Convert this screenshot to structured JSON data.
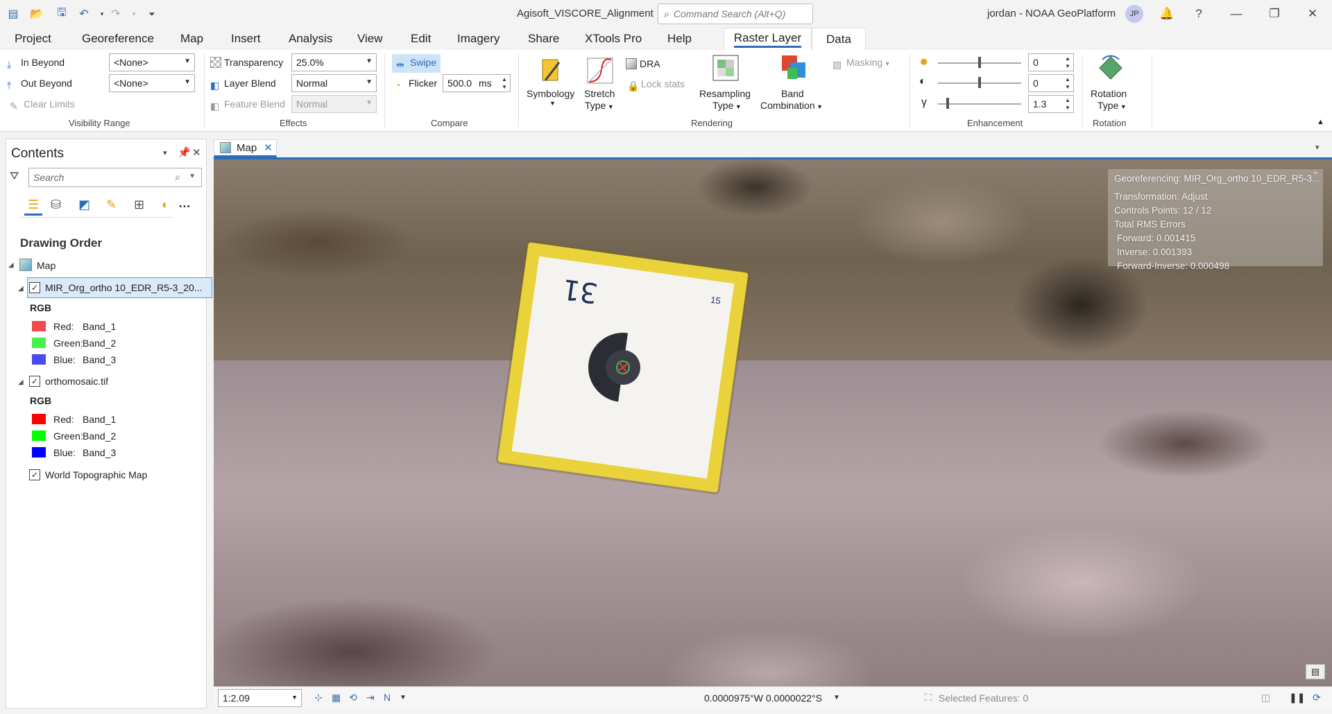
{
  "titlebar": {
    "app_title": "Agisoft_VISCORE_Alignment",
    "search_placeholder": "Command Search (Alt+Q)",
    "user": "jordan - NOAA GeoPlatform",
    "avatar_initials": "JP",
    "help": "?"
  },
  "menu": {
    "items": [
      "Project",
      "Georeference",
      "Map",
      "Insert",
      "Analysis",
      "View",
      "Edit",
      "Imagery",
      "Share",
      "XTools Pro",
      "Help"
    ],
    "active_tab": "Raster Layer",
    "data_tab": "Data"
  },
  "ribbon": {
    "visibility": {
      "in_beyond": "In Beyond",
      "out_beyond": "Out Beyond",
      "clear_limits": "Clear Limits",
      "in_value": "<None>",
      "out_value": "<None>",
      "group": "Visibility Range"
    },
    "effects": {
      "transparency_label": "Transparency",
      "transparency_value": "25.0%",
      "layer_blend_label": "Layer Blend",
      "layer_blend_value": "Normal",
      "feature_blend_label": "Feature Blend",
      "feature_blend_value": "Normal",
      "group": "Effects"
    },
    "compare": {
      "swipe": "Swipe",
      "flicker": "Flicker",
      "flicker_value": "500.0",
      "flicker_unit": "ms",
      "group": "Compare"
    },
    "rendering": {
      "symbology": "Symbology",
      "stretch_type_1": "Stretch",
      "stretch_type_2": "Type",
      "dra": "DRA",
      "lock_stats": "Lock stats",
      "resampling_1": "Resampling",
      "resampling_2": "Type",
      "band_1": "Band",
      "band_2": "Combination",
      "masking": "Masking",
      "group": "Rendering"
    },
    "enhancement": {
      "brightness": "0",
      "contrast": "0",
      "gamma": "1.3",
      "gamma_symbol": "γ",
      "group": "Enhancement"
    },
    "rotation": {
      "label_1": "Rotation",
      "label_2": "Type",
      "group": "Rotation"
    }
  },
  "contents": {
    "title": "Contents",
    "search_placeholder": "Search",
    "drawing_order": "Drawing Order",
    "map_node": "Map",
    "layers": [
      {
        "name": "MIR_Org_ortho 10_EDR_R5-3_20...",
        "renderer": "RGB",
        "bands": [
          {
            "label": "Red:",
            "band": "Band_1",
            "color": "#f04a4a"
          },
          {
            "label": "Green:",
            "band": "Band_2",
            "color": "#4af04a"
          },
          {
            "label": "Blue:",
            "band": "Band_3",
            "color": "#4a4af0"
          }
        ]
      },
      {
        "name": "orthomosaic.tif",
        "renderer": "RGB",
        "bands": [
          {
            "label": "Red:",
            "band": "Band_1",
            "color": "#ff0000"
          },
          {
            "label": "Green:",
            "band": "Band_2",
            "color": "#00ff00"
          },
          {
            "label": "Blue:",
            "band": "Band_3",
            "color": "#0000ff"
          }
        ]
      }
    ],
    "basemap": "World Topographic Map"
  },
  "map": {
    "tab_label": "Map",
    "plate_label": "31",
    "plate_small_label": "15",
    "georef": {
      "title": "Georeferencing: MIR_Org_ortho 10_EDR_R5-3...",
      "transformation": "Transformation: Adjust",
      "control_points": "Controls Points: 12 / 12",
      "rms_title": "Total RMS Errors",
      "forward": "Forward: 0.001415",
      "inverse": "Inverse: 0.001393",
      "forward_inverse": "Forward-Inverse: 0.000498"
    }
  },
  "status": {
    "scale": "1:2.09",
    "coords": "0.0000975°W 0.0000022°S",
    "selected_features": "Selected Features: 0"
  }
}
